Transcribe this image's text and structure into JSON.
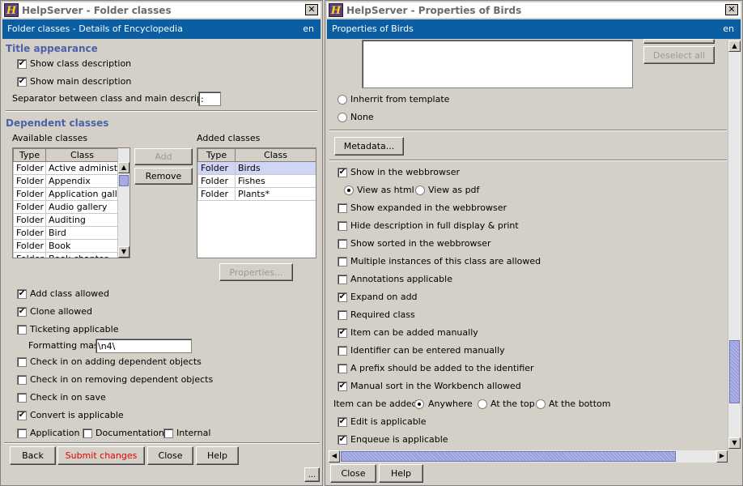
{
  "left": {
    "title": "HelpServer - Folder classes",
    "header": "Folder classes - Details of Encyclopedia",
    "lang": "en",
    "title_appearance": {
      "heading": "Title appearance",
      "show_class_description": "Show class description",
      "show_main_description": "Show main description",
      "separator_label": "Separator between class and main description",
      "separator_value": ":"
    },
    "dependent": {
      "heading": "Dependent classes",
      "available_label": "Available classes",
      "added_label": "Added classes",
      "col_type": "Type",
      "col_class": "Class",
      "available_rows": [
        {
          "type": "Folder",
          "cls": "Active administr..."
        },
        {
          "type": "Folder",
          "cls": "Appendix"
        },
        {
          "type": "Folder",
          "cls": "Application gall..."
        },
        {
          "type": "Folder",
          "cls": "Audio gallery"
        },
        {
          "type": "Folder",
          "cls": "Auditing"
        },
        {
          "type": "Folder",
          "cls": "Bird"
        },
        {
          "type": "Folder",
          "cls": "Book"
        },
        {
          "type": "Folder",
          "cls": "Book chapter"
        }
      ],
      "added_rows": [
        {
          "type": "Folder",
          "cls": "Birds"
        },
        {
          "type": "Folder",
          "cls": "Fishes"
        },
        {
          "type": "Folder",
          "cls": "Plants*"
        }
      ],
      "add_button": "Add",
      "remove_button": "Remove",
      "properties_button": "Properties..."
    },
    "options": {
      "add_class_allowed": "Add class allowed",
      "clone_allowed": "Clone allowed",
      "ticketing_applicable": "Ticketing applicable",
      "formatting_mask_label": "Formatting mask",
      "formatting_mask_value": "\\n4\\",
      "check_in_adding": "Check in on adding dependent objects",
      "check_in_removing": "Check in on removing dependent objects",
      "check_in_save": "Check in on save",
      "convert_applicable": "Convert is applicable",
      "application": "Application",
      "documentation": "Documentation",
      "internal": "Internal"
    },
    "buttons": {
      "back": "Back",
      "submit": "Submit changes",
      "close": "Close",
      "help": "Help",
      "more": "..."
    }
  },
  "right": {
    "title": "HelpServer - Properties of Birds",
    "header": "Properties of Birds",
    "lang": "en",
    "deselect_all": "Deselect all",
    "inherit_from_template": "Inherrit from template",
    "none": "None",
    "metadata_button": "Metadata...",
    "show_in_webbrowser": "Show in the webbrowser",
    "view_as_html": "View as html",
    "view_as_pdf": "View as pdf",
    "options": [
      "Show expanded in the webbrowser",
      "Hide description in full display & print",
      "Show sorted in the webbrowser",
      "Multiple instances of this class are allowed",
      "Annotations applicable",
      "Expand on add",
      "Required class",
      "Item can be added manually",
      "Identifier can be entered manually",
      "A prefix should be added to the identifier",
      "Manual sort in the Workbench allowed"
    ],
    "item_can_be_added_label": "Item can be added",
    "anywhere": "Anywhere",
    "at_the_top": "At the top",
    "at_the_bottom": "At the bottom",
    "edit_applicable": "Edit is applicable",
    "enqueue_applicable": "Enqueue is applicable",
    "buttons": {
      "close": "Close",
      "help": "Help"
    }
  },
  "checked_mark": "✔",
  "close_glyph": "✕",
  "colors": {
    "header_bg": "#0b5ea2",
    "section_title": "#4b62a8",
    "submit_text": "#e00000",
    "selection": "#d0d4f5"
  }
}
